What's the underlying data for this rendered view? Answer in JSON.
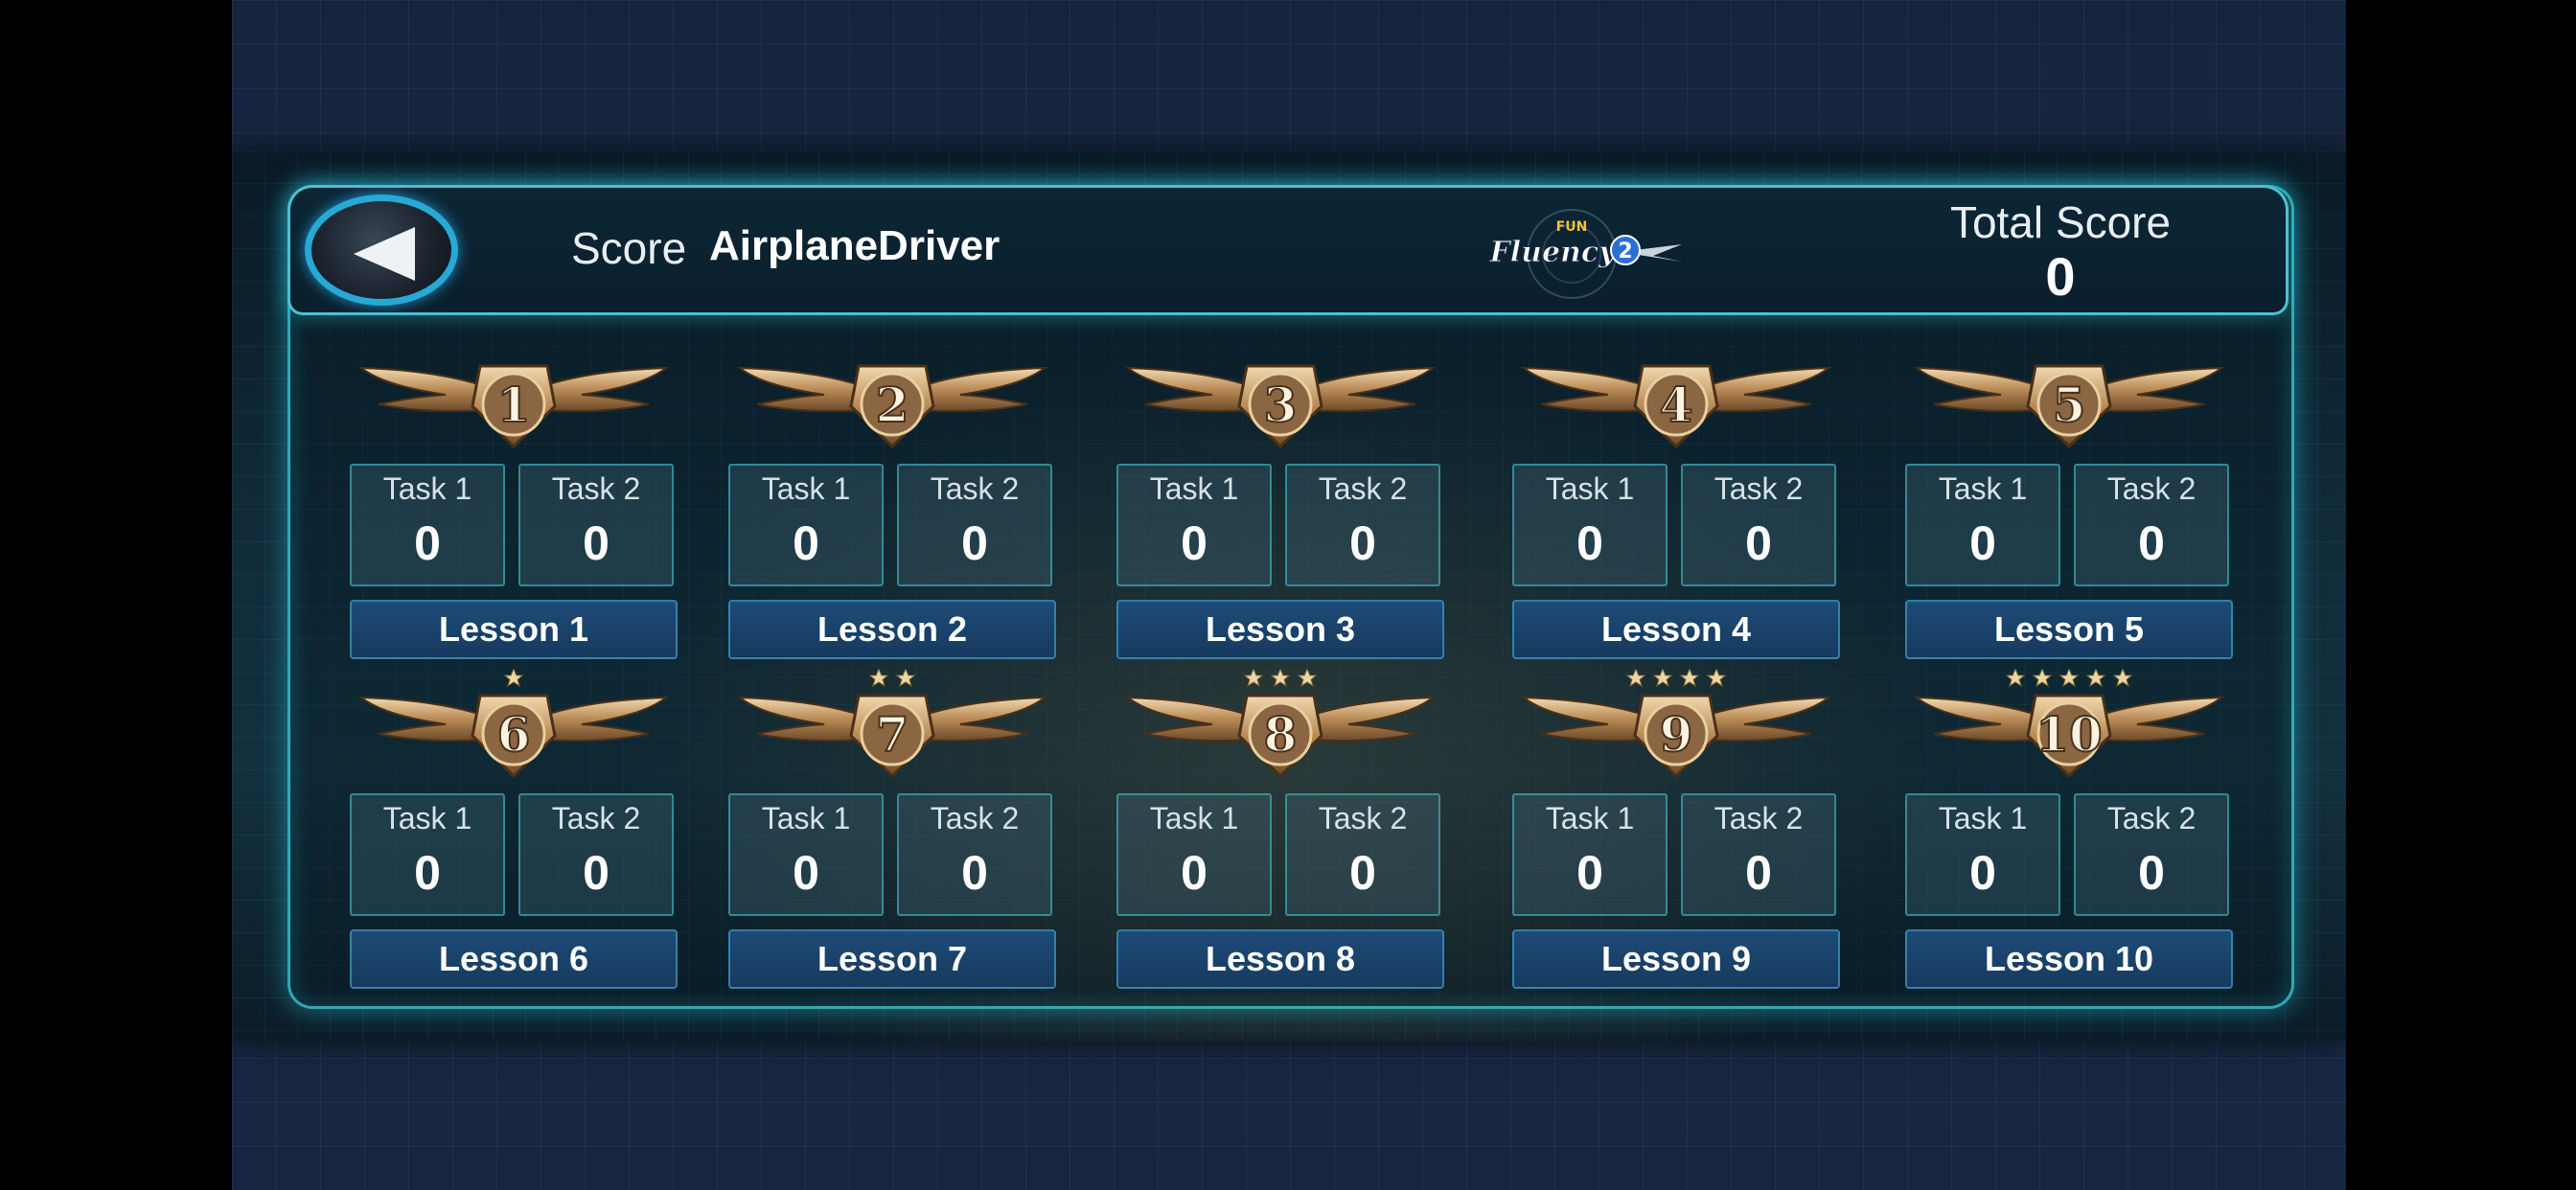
{
  "header": {
    "score_label": "Score",
    "player_name": "AirplaneDriver",
    "logo_top": "FUN",
    "logo_main": "Fluency",
    "logo_number": "2",
    "total_score_label": "Total Score",
    "total_score_value": "0"
  },
  "colors": {
    "accent": "#46d2e1",
    "back_ring": "#27a9d6",
    "lesson_button": "#1d4b78"
  },
  "lessons": [
    {
      "badge": "1",
      "stars": 0,
      "task1_label": "Task 1",
      "task1_value": "0",
      "task2_label": "Task 2",
      "task2_value": "0",
      "label": "Lesson 1"
    },
    {
      "badge": "2",
      "stars": 0,
      "task1_label": "Task 1",
      "task1_value": "0",
      "task2_label": "Task 2",
      "task2_value": "0",
      "label": "Lesson 2"
    },
    {
      "badge": "3",
      "stars": 0,
      "task1_label": "Task 1",
      "task1_value": "0",
      "task2_label": "Task 2",
      "task2_value": "0",
      "label": "Lesson 3"
    },
    {
      "badge": "4",
      "stars": 0,
      "task1_label": "Task 1",
      "task1_value": "0",
      "task2_label": "Task 2",
      "task2_value": "0",
      "label": "Lesson 4"
    },
    {
      "badge": "5",
      "stars": 0,
      "task1_label": "Task 1",
      "task1_value": "0",
      "task2_label": "Task 2",
      "task2_value": "0",
      "label": "Lesson 5"
    },
    {
      "badge": "6",
      "stars": 1,
      "task1_label": "Task 1",
      "task1_value": "0",
      "task2_label": "Task 2",
      "task2_value": "0",
      "label": "Lesson 6"
    },
    {
      "badge": "7",
      "stars": 2,
      "task1_label": "Task 1",
      "task1_value": "0",
      "task2_label": "Task 2",
      "task2_value": "0",
      "label": "Lesson 7"
    },
    {
      "badge": "8",
      "stars": 3,
      "task1_label": "Task 1",
      "task1_value": "0",
      "task2_label": "Task 2",
      "task2_value": "0",
      "label": "Lesson 8"
    },
    {
      "badge": "9",
      "stars": 4,
      "task1_label": "Task 1",
      "task1_value": "0",
      "task2_label": "Task 2",
      "task2_value": "0",
      "label": "Lesson 9"
    },
    {
      "badge": "10",
      "stars": 5,
      "task1_label": "Task 1",
      "task1_value": "0",
      "task2_label": "Task 2",
      "task2_value": "0",
      "label": "Lesson 10"
    }
  ],
  "icons": {
    "back": "back-arrow-icon",
    "badge": "winged-rank-badge-icon",
    "star": "star-icon"
  }
}
